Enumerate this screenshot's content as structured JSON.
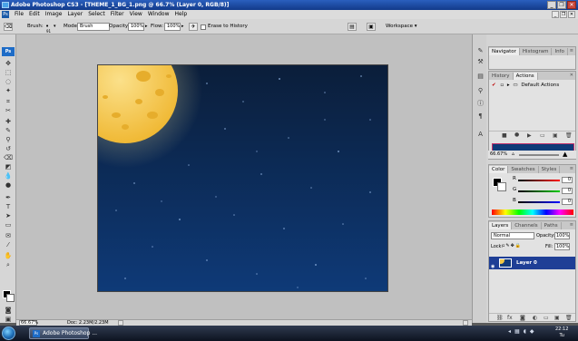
{
  "window": {
    "title": "Adobe Photoshop CS3 - [THEME_1_BG_1.png @ 66.7% (Layer 0, RGB/8)]"
  },
  "menu": [
    "File",
    "Edit",
    "Image",
    "Layer",
    "Select",
    "Filter",
    "View",
    "Window",
    "Help"
  ],
  "options": {
    "brush_label": "Brush:",
    "brush_size": "91",
    "mode_label": "Mode:",
    "mode_value": "Brush",
    "opacity_label": "Opacity:",
    "opacity_value": "100%",
    "flow_label": "Flow:",
    "flow_value": "100%",
    "erase_history_label": "Erase to History",
    "workspace_label": "Workspace ▾"
  },
  "toolbox": {
    "logo": "Ps"
  },
  "statusbar": {
    "zoom": "66.67%",
    "doc_info": "Doc: 2.23M/2.23M"
  },
  "navigator": {
    "tabs": [
      "Navigator",
      "Histogram",
      "Info"
    ],
    "zoom": "66.67%"
  },
  "history": {
    "tabs": [
      "History",
      "Actions"
    ],
    "items": [
      "Default Actions"
    ]
  },
  "color": {
    "tabs": [
      "Color",
      "Swatches",
      "Styles"
    ],
    "channels": [
      {
        "label": "R",
        "value": "0"
      },
      {
        "label": "G",
        "value": "0"
      },
      {
        "label": "B",
        "value": "0"
      }
    ]
  },
  "layers": {
    "tabs": [
      "Layers",
      "Channels",
      "Paths"
    ],
    "blend_mode": "Normal",
    "opacity_label": "Opacity:",
    "opacity_value": "100%",
    "lock_label": "Lock:",
    "fill_label": "Fill:",
    "fill_value": "100%",
    "items": [
      {
        "name": "Layer 0"
      }
    ]
  },
  "taskbar": {
    "app_button": "Adobe Photoshop ...",
    "clock_time": "22:12",
    "clock_suffix": "Tu"
  },
  "colors": {
    "titlebar": "#2a5fbe",
    "night_sky_top": "#0b1e3a",
    "night_sky_bottom": "#0e3a78",
    "moon": "#f4c94a",
    "layer_selected": "#1f3f96"
  }
}
